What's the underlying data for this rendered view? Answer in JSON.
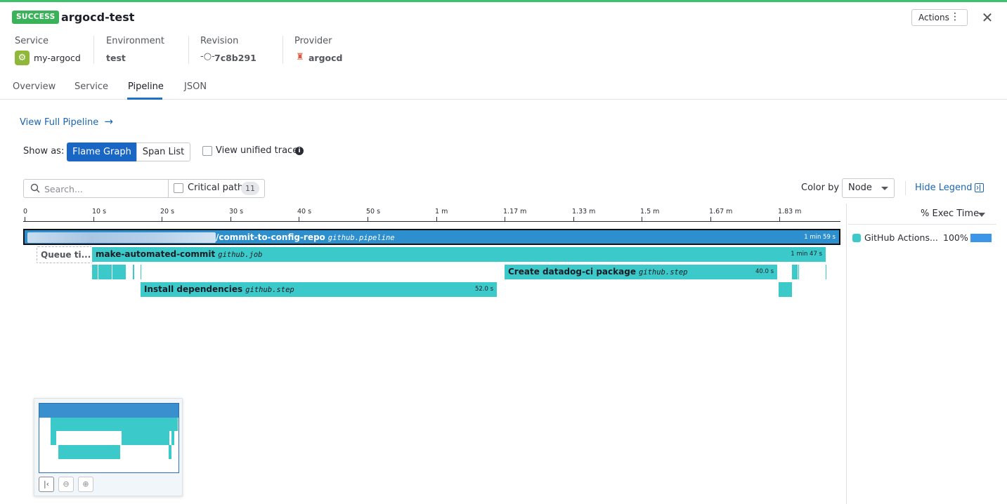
{
  "header": {
    "status_badge": "SUCCESS",
    "title": "argocd-test",
    "actions_label": "Actions",
    "close_glyph": "✕"
  },
  "meta": {
    "service_label": "Service",
    "service_value": "my-argocd",
    "environment_label": "Environment",
    "environment_value": "test",
    "revision_label": "Revision",
    "revision_value": "7c8b291",
    "provider_label": "Provider",
    "provider_value": "argocd"
  },
  "tabs": [
    {
      "label": "Overview"
    },
    {
      "label": "Service"
    },
    {
      "label": "Pipeline",
      "active": true
    },
    {
      "label": "JSON"
    }
  ],
  "pipeline": {
    "view_full_label": "View Full Pipeline",
    "show_as_label": "Show as:",
    "flame_graph_label": "Flame Graph",
    "span_list_label": "Span List",
    "unified_trace_label": "View unified trace"
  },
  "toolbar": {
    "search_placeholder": "Search...",
    "critical_path_label": "Critical path",
    "critical_path_count": "11",
    "color_by_label": "Color by",
    "color_by_value": "Node",
    "hide_legend_label": "Hide Legend"
  },
  "timeline": {
    "ticks": [
      "0",
      "10 s",
      "20 s",
      "30 s",
      "40 s",
      "50 s",
      "1 m",
      "1.17 m",
      "1.33 m",
      "1.5 m",
      "1.67 m",
      "1.83 m"
    ]
  },
  "spans": {
    "root": {
      "name": "/commit-to-config-repo",
      "kind": "github.pipeline",
      "duration": "1 min 59 s"
    },
    "queue": {
      "name": "Queue ti..."
    },
    "job": {
      "name": "make-automated-commit",
      "kind": "github.job",
      "duration": "1 min 47 s"
    },
    "create_pkg": {
      "name": "Create datadog-ci package",
      "kind": "github.step",
      "duration": "40.0 s"
    },
    "install": {
      "name": "Install dependencies",
      "kind": "github.step",
      "duration": "52.0 s"
    }
  },
  "legend": {
    "header": "% Exec Time",
    "items": [
      {
        "name": "GitHub Actions...",
        "percent": "100%",
        "fraction": 1.0,
        "color": "#3cc9c9"
      }
    ]
  },
  "colors": {
    "accent": "#1a66c4",
    "success": "#3ab25a",
    "span_teal": "#3cc9c9",
    "root_span": "#2e8fcf"
  }
}
